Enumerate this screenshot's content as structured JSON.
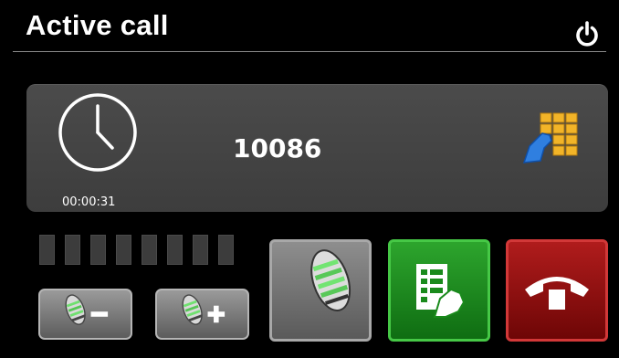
{
  "header": {
    "title": "Active call"
  },
  "call": {
    "timer": "00:00:31",
    "number": "10086"
  },
  "signal": {
    "bars_total": 8,
    "bars_active": 0
  },
  "icons": {
    "power": "power-icon",
    "clock": "clock-icon",
    "keypad": "keypad-icon",
    "volume_down": "mic-volume-down-icon",
    "volume_up": "mic-volume-up-icon",
    "mute": "microphone-icon",
    "transfer": "call-transfer-icon",
    "hangup": "hang-up-icon"
  },
  "colors": {
    "transfer": "#1a8a1c",
    "hangup": "#8e0d0d",
    "panel": "#444444"
  }
}
